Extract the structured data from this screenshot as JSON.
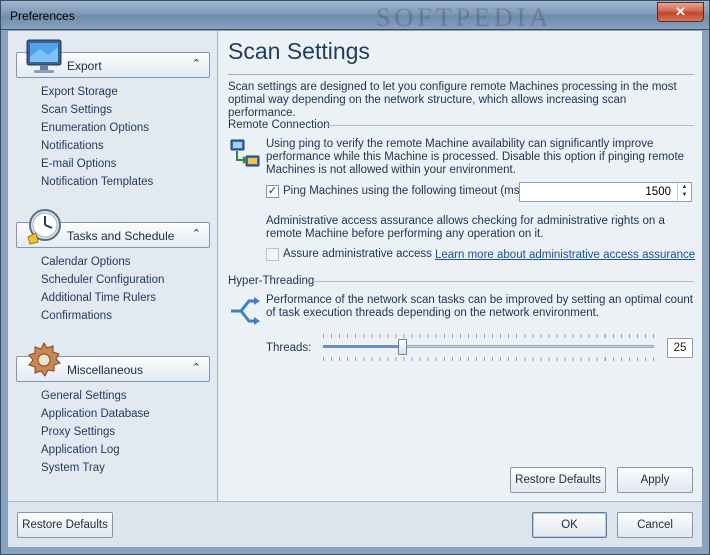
{
  "window": {
    "title": "Preferences",
    "watermark": "SOFTPEDIA",
    "close_glyph": "✕"
  },
  "sidebar": {
    "groups": [
      {
        "title": "Export",
        "icon": "monitor-icon",
        "items": [
          "Export Storage",
          "Scan Settings",
          "Enumeration Options",
          "Notifications",
          "E-mail Options",
          "Notification Templates"
        ]
      },
      {
        "title": "Tasks and Schedule",
        "icon": "clock-icon",
        "items": [
          "Calendar Options",
          "Scheduler Configuration",
          "Additional Time Rulers",
          "Confirmations"
        ]
      },
      {
        "title": "Miscellaneous",
        "icon": "gear-icon",
        "items": [
          "General Settings",
          "Application Database",
          "Proxy Settings",
          "Application Log",
          "System Tray"
        ]
      }
    ],
    "collapse_glyph": "⌃"
  },
  "main": {
    "title": "Scan Settings",
    "description": "Scan settings are designed to let you configure remote Machines processing in the most optimal way depending on the network structure, which allows increasing scan performance.",
    "remote_connection": {
      "heading": "Remote Connection",
      "ping_text": "Using ping to verify the remote Machine availability can significantly improve performance while this Machine is processed. Disable this option if pinging remote Machines is not allowed within your environment.",
      "ping_checkbox_label": "Ping Machines using the following timeout (ms.):",
      "ping_checked": true,
      "timeout_value": "1500",
      "admin_text": "Administrative access assurance allows checking for administrative rights on a remote Machine before performing any operation on it.",
      "assure_checkbox_label": "Assure administrative access",
      "assure_checked": false,
      "learn_more_link": "Learn more about administrative access assurance"
    },
    "hyper_threading": {
      "heading": "Hyper-Threading",
      "text": "Performance of the network scan tasks can be improved by setting an optimal count of task execution threads depending on the network environment.",
      "threads_label": "Threads:",
      "threads_value": "25",
      "threads_fraction": 0.24
    },
    "buttons": {
      "restore_defaults": "Restore Defaults",
      "apply": "Apply"
    }
  },
  "footer": {
    "restore_defaults": "Restore Defaults",
    "ok": "OK",
    "cancel": "Cancel"
  },
  "colors": {
    "accent": "#1f3b5e",
    "link": "#1a4fa0"
  }
}
